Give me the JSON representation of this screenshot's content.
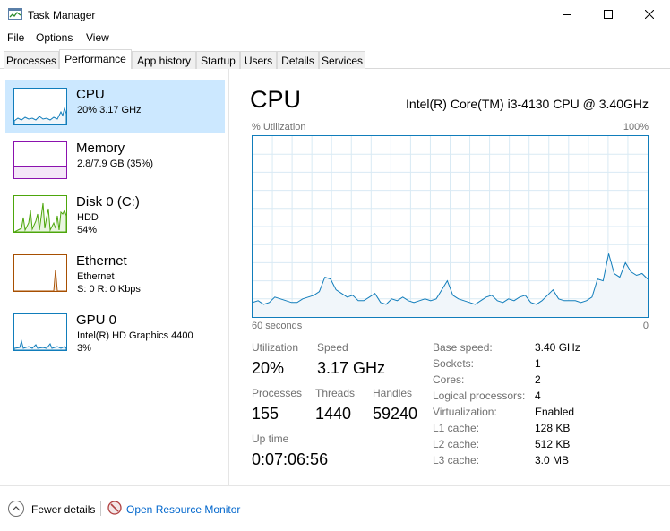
{
  "window": {
    "title": "Task Manager"
  },
  "menu": [
    "File",
    "Options",
    "View"
  ],
  "tabs": [
    "Processes",
    "Performance",
    "App history",
    "Startup",
    "Users",
    "Details",
    "Services"
  ],
  "resources": [
    {
      "name": "CPU",
      "lines": [
        "20%  3.17 GHz"
      ],
      "color": "#117dbb"
    },
    {
      "name": "Memory",
      "lines": [
        "2.8/7.9 GB (35%)"
      ],
      "color": "#8b12ae"
    },
    {
      "name": "Disk 0 (C:)",
      "lines": [
        "HDD",
        "54%"
      ],
      "color": "#4da60c"
    },
    {
      "name": "Ethernet",
      "lines": [
        "Ethernet",
        "S: 0  R: 0 Kbps"
      ],
      "color": "#a74f01"
    },
    {
      "name": "GPU 0",
      "lines": [
        "Intel(R) HD Graphics 4400",
        "3%"
      ],
      "color": "#117dbb"
    }
  ],
  "main": {
    "heading": "CPU",
    "model": "Intel(R) Core(TM) i3-4130 CPU @ 3.40GHz",
    "util_label": "% Utilization",
    "util_max": "100%",
    "axis_left": "60 seconds",
    "axis_right": "0",
    "utilization_history": [
      8,
      9,
      7,
      8,
      11,
      10,
      9,
      8,
      8,
      10,
      11,
      12,
      14,
      22,
      21,
      15,
      13,
      11,
      12,
      9,
      9,
      11,
      13,
      8,
      7,
      10,
      9,
      11,
      9,
      8,
      9,
      10,
      9,
      10,
      15,
      20,
      12,
      10,
      9,
      8,
      7,
      9,
      11,
      12,
      9,
      8,
      10,
      9,
      11,
      12,
      8,
      7,
      9,
      12,
      15,
      10,
      9,
      9,
      9,
      8,
      9,
      11,
      21,
      20,
      35,
      24,
      22,
      30,
      25,
      23,
      24,
      21
    ]
  },
  "stats": {
    "utilization": {
      "label": "Utilization",
      "value": "20%"
    },
    "speed": {
      "label": "Speed",
      "value": "3.17 GHz"
    },
    "processes": {
      "label": "Processes",
      "value": "155"
    },
    "threads": {
      "label": "Threads",
      "value": "1440"
    },
    "handles": {
      "label": "Handles",
      "value": "59240"
    },
    "uptime": {
      "label": "Up time",
      "value": "0:07:06:56"
    }
  },
  "specs": [
    {
      "label": "Base speed:",
      "value": "3.40 GHz"
    },
    {
      "label": "Sockets:",
      "value": "1"
    },
    {
      "label": "Cores:",
      "value": "2"
    },
    {
      "label": "Logical processors:",
      "value": "4"
    },
    {
      "label": "Virtualization:",
      "value": "Enabled"
    },
    {
      "label": "L1 cache:",
      "value": "128 KB"
    },
    {
      "label": "L2 cache:",
      "value": "512 KB"
    },
    {
      "label": "L3 cache:",
      "value": "3.0 MB"
    }
  ],
  "footer": {
    "fewer_details": "Fewer details",
    "open_monitor": "Open Resource Monitor"
  }
}
